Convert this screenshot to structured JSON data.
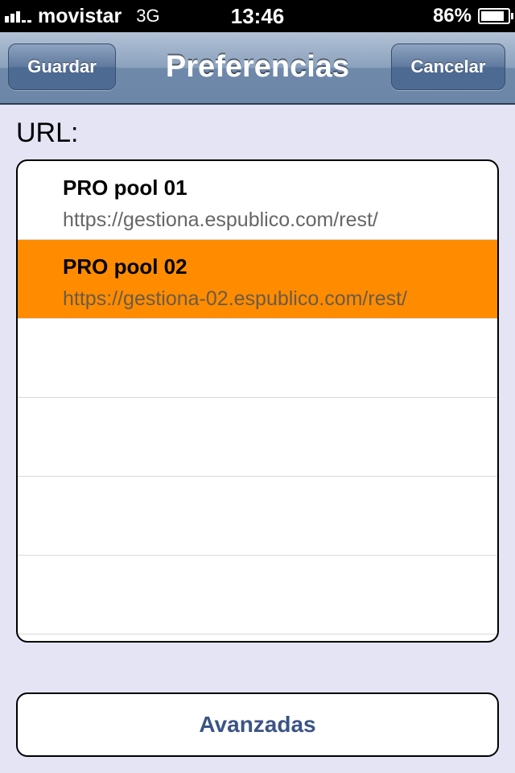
{
  "status_bar": {
    "carrier": "movistar",
    "network": "3G",
    "time": "13:46",
    "battery": "86%",
    "battery_level": 0.86
  },
  "nav": {
    "title": "Preferencias",
    "save_label": "Guardar",
    "cancel_label": "Cancelar"
  },
  "form": {
    "url_label": "URL:"
  },
  "url_list": {
    "selected_index": 1,
    "items": [
      {
        "title": "PRO pool 01",
        "url": "https://gestiona.espublico.com/rest/"
      },
      {
        "title": "PRO pool 02",
        "url": "https://gestiona-02.espublico.com/rest/"
      }
    ],
    "empty_rows": 4
  },
  "advanced_button": {
    "label": "Avanzadas"
  },
  "colors": {
    "selection": "#ff8c00",
    "nav_bar": "#6f89aa",
    "background": "#e4e4f5",
    "button_text": "#3b5486"
  }
}
